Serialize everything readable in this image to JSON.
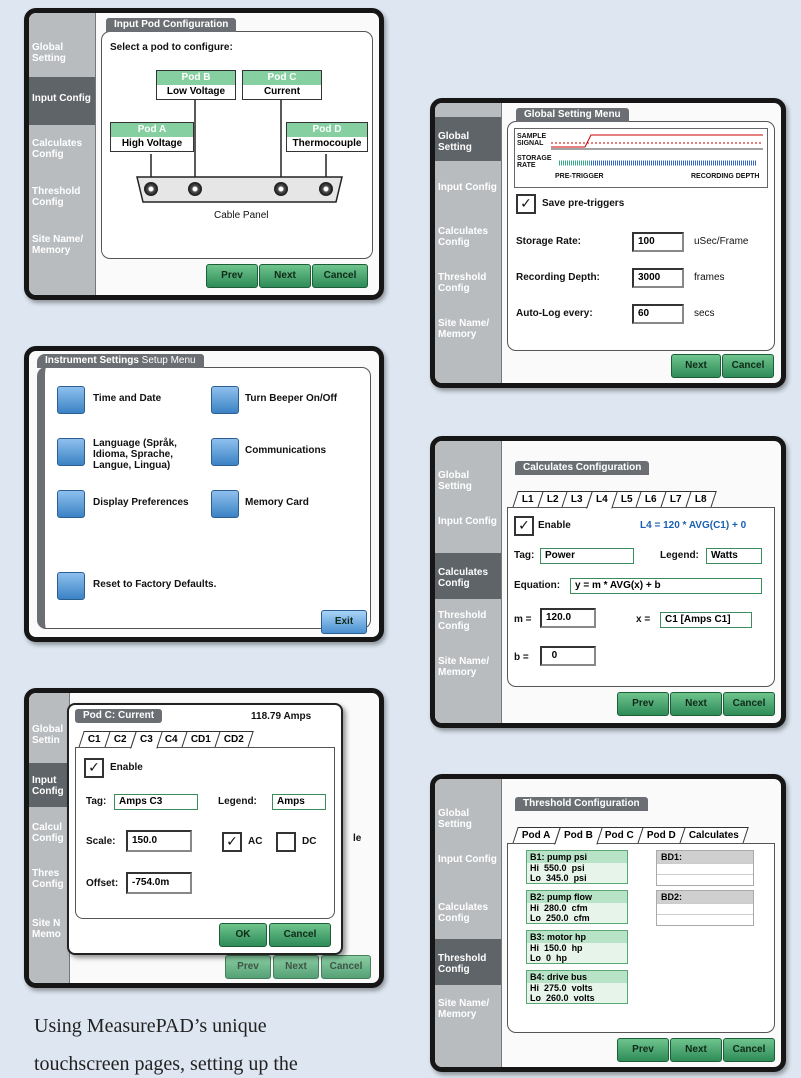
{
  "sidebar": {
    "global": "Global Setting",
    "input": "Input Config",
    "calc": "Calculates Config",
    "threshold": "Threshold Config",
    "site": "Site Name/ Memory"
  },
  "buttons": {
    "prev": "Prev",
    "next": "Next",
    "cancel": "Cancel",
    "exit": "Exit",
    "ok": "OK"
  },
  "input_pod": {
    "title": "Input Pod Configuration",
    "prompt": "Select a pod to configure:",
    "pods": [
      {
        "id": "Pod B",
        "name": "Low Voltage"
      },
      {
        "id": "Pod C",
        "name": "Current"
      },
      {
        "id": "Pod A",
        "name": "High Voltage"
      },
      {
        "id": "Pod D",
        "name": "Thermocouple"
      }
    ],
    "cable_panel": "Cable Panel"
  },
  "global_setting": {
    "title": "Global Setting Menu",
    "sample_signal": "SAMPLE SIGNAL",
    "storage_rate_lbl": "STORAGE RATE",
    "pre_trigger": "PRE-TRIGGER",
    "recording_depth_lbl": "RECORDING DEPTH",
    "save_pretriggers": "Save pre-triggers",
    "storage_rate": {
      "label": "Storage Rate:",
      "value": "100",
      "unit": "uSec/Frame"
    },
    "recording_depth": {
      "label": "Recording Depth:",
      "value": "3000",
      "unit": "frames"
    },
    "auto_log": {
      "label": "Auto-Log every:",
      "value": "60",
      "unit": "secs"
    }
  },
  "instrument": {
    "title_bold": "Instrument Settings",
    "title_rest": " Setup Menu",
    "items": {
      "time": "Time and Date",
      "beeper": "Turn Beeper On/Off",
      "language": "Language (Språk, Idioma, Sprache, Langue, Lingua)",
      "comms": "Communications",
      "display": "Display Preferences",
      "memory": "Memory Card",
      "reset": "Reset to Factory Defaults."
    }
  },
  "calculates": {
    "title": "Calculates Configuration",
    "tabs": [
      "L1",
      "L2",
      "L3",
      "L4",
      "L5",
      "L6",
      "L7",
      "L8"
    ],
    "enable": "Enable",
    "formula": "L4 = 120 * AVG(C1) + 0",
    "tag_label": "Tag:",
    "tag_value": "Power",
    "legend_label": "Legend:",
    "legend_value": "Watts",
    "equation_label": "Equation:",
    "equation_value": "y = m * AVG(x) + b",
    "m_label": "m =",
    "m_value": "120.0",
    "x_label": "x =",
    "x_value": "C1 [Amps C1]",
    "b_label": "b =",
    "b_value": "0"
  },
  "pod_c": {
    "title": "Pod C: Current",
    "reading": "118.79 Amps",
    "tabs": [
      "C1",
      "C2",
      "C3",
      "C4",
      "CD1",
      "CD2"
    ],
    "enable": "Enable",
    "tag_label": "Tag:",
    "tag_value": "Amps C3",
    "legend_label": "Legend:",
    "legend_value": "Amps",
    "scale_label": "Scale:",
    "scale_value": "150.0",
    "ac": "AC",
    "dc": "DC",
    "offset_label": "Offset:",
    "offset_value": "-754.0m",
    "behind_fragment": "le",
    "side_fragments": {
      "global": "Global Settin",
      "input": "Input Config",
      "calc": "Calcul Config",
      "thres": "Thres Config",
      "site": "Site N Memo"
    }
  },
  "threshold": {
    "title": "Threshold Configuration",
    "tabs": [
      "Pod A",
      "Pod B",
      "Pod C",
      "Pod D",
      "Calculates"
    ],
    "groups": [
      {
        "name": "B1: pump psi",
        "hi": "550.0",
        "hi_unit": "psi",
        "lo": "345.0",
        "lo_unit": "psi"
      },
      {
        "name": "B2: pump flow",
        "hi": "280.0",
        "hi_unit": "cfm",
        "lo": "250.0",
        "lo_unit": "cfm"
      },
      {
        "name": "B3: motor hp",
        "hi": "150.0",
        "hi_unit": "hp",
        "lo": "0",
        "lo_unit": "hp"
      },
      {
        "name": "B4: drive bus",
        "hi": "275.0",
        "hi_unit": "volts",
        "lo": "260.0",
        "lo_unit": "volts"
      }
    ],
    "hi": "Hi",
    "lo": "Lo",
    "bd1": "BD1:",
    "bd2": "BD2:"
  },
  "caption": {
    "line1": "Using MeasurePAD’s unique",
    "line2": "touchscreen pages, setting up the"
  }
}
